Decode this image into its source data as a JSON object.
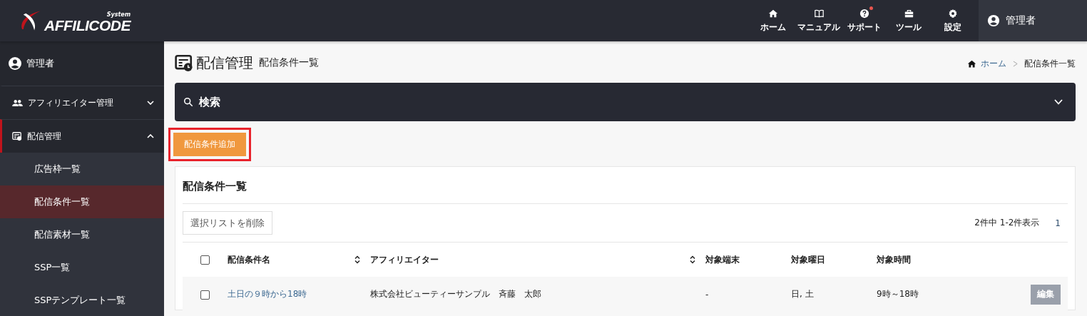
{
  "header": {
    "logo": {
      "super": "System",
      "name": "AFFILICODE"
    },
    "nav": [
      {
        "label": "ホーム",
        "badge": false
      },
      {
        "label": "マニュアル",
        "badge": false
      },
      {
        "label": "サポート",
        "badge": true
      },
      {
        "label": "ツール",
        "badge": false
      },
      {
        "label": "設定",
        "badge": false
      }
    ],
    "user": "管理者"
  },
  "sidebar": {
    "user": "管理者",
    "groups": [
      {
        "label": "アフィリエイター管理",
        "expanded": false,
        "active": false
      },
      {
        "label": "配信管理",
        "expanded": true,
        "active": true,
        "children": [
          {
            "label": "広告枠一覧",
            "selected": false
          },
          {
            "label": "配信条件一覧",
            "selected": true
          },
          {
            "label": "配信素材一覧",
            "selected": false
          },
          {
            "label": "SSP一覧",
            "selected": false
          },
          {
            "label": "SSPテンプレート一覧",
            "selected": false
          }
        ]
      }
    ]
  },
  "page": {
    "title": "配信管理",
    "subtitle": "配信条件一覧",
    "breadcrumb": [
      {
        "label": "ホーム",
        "kind": "link"
      },
      {
        "label": "配信条件一覧",
        "kind": "current"
      }
    ],
    "search": {
      "label": "検索",
      "expanded": false
    },
    "add_button": {
      "label": "配信条件追加",
      "highlighted": true
    },
    "card": {
      "title": "配信条件一覧",
      "delete_button": "選択リストを削除",
      "summary": "2件中 1-2件表示",
      "pages": [
        "1"
      ],
      "select_all": {
        "checked": false
      },
      "columns": [
        {
          "label": "配信条件名",
          "sortable": true
        },
        {
          "label": "アフィリエイター",
          "sortable": true
        },
        {
          "label": "対象端末",
          "sortable": false
        },
        {
          "label": "対象曜日",
          "sortable": false
        },
        {
          "label": "対象時間",
          "sortable": false
        }
      ],
      "rows": [
        {
          "checked": false,
          "name": "土日の９時から18時",
          "affiliate": "株式会社ビューティーサンプル　斉藤　太郎",
          "device": "-",
          "weekdays": "日, 土",
          "time": "9時～18時",
          "action": "編集"
        }
      ]
    }
  }
}
